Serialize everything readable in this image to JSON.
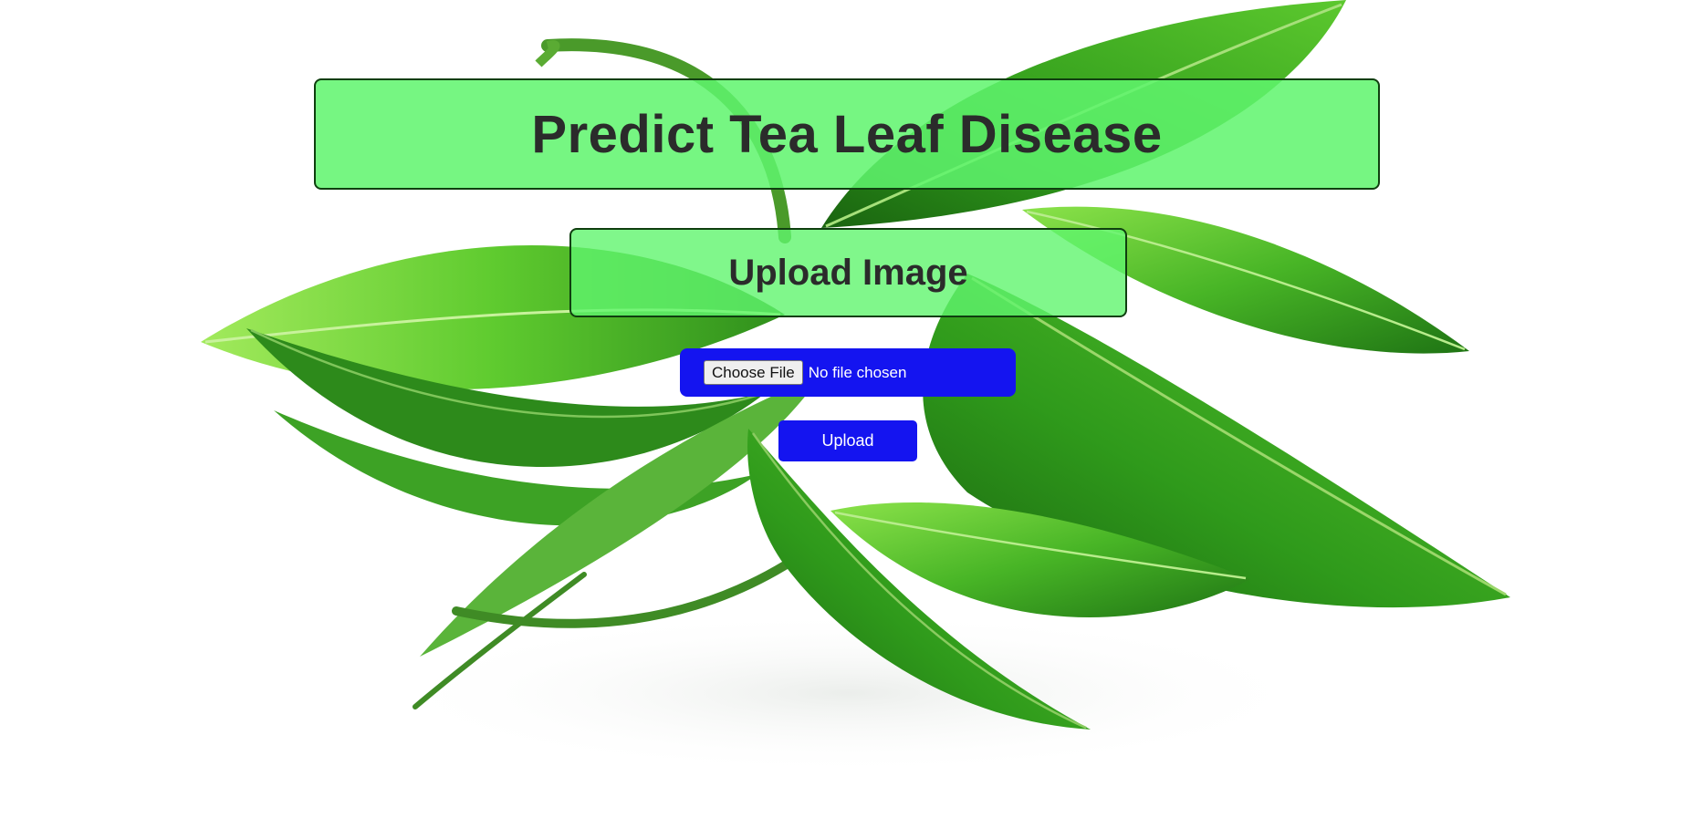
{
  "header": {
    "title": "Predict Tea Leaf Disease"
  },
  "upload": {
    "heading": "Upload Image",
    "file_input": {
      "button_label": "Choose File",
      "status": "No file chosen"
    },
    "submit_label": "Upload"
  },
  "background": {
    "subject": "tea-leaves-image",
    "colors": {
      "page": "#ffffff",
      "leaf_light": "#7ddc3a",
      "leaf_mid": "#3fae1f",
      "leaf_dark": "#1f6f12"
    }
  },
  "colors": {
    "panel_green": "#60f56e",
    "panel_border": "#0f3f0f",
    "button_blue": "#1414f0",
    "text_dark": "#2b2b2b",
    "text_light": "#ffffff"
  }
}
